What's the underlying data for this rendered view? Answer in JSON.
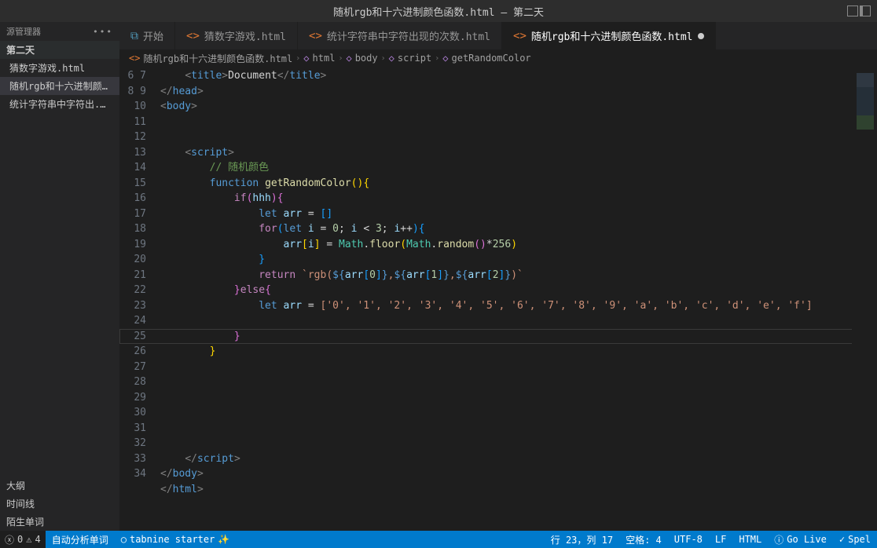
{
  "title": "随机rgb和十六进制颜色函数.html — 第二天",
  "explorer": {
    "label": "源管理器",
    "section": "第二天",
    "files": [
      "猜数字游戏.html",
      "随机rgb和十六进制颜...",
      "统计字符串中字符出..."
    ],
    "activeIndex": 1,
    "bottom": [
      "大纲",
      "时间线",
      "陌生单词"
    ]
  },
  "tabs": [
    {
      "label": "开始",
      "icon": "vscode"
    },
    {
      "label": "猜数字游戏.html",
      "icon": "html"
    },
    {
      "label": "统计字符串中字符出现的次数.html",
      "icon": "html"
    },
    {
      "label": "随机rgb和十六进制颜色函数.html",
      "icon": "html",
      "active": true,
      "dirty": true
    }
  ],
  "breadcrumbs": [
    "随机rgb和十六进制颜色函数.html",
    "html",
    "body",
    "script",
    "getRandomColor"
  ],
  "gutter_start": 6,
  "gutter_end": 34,
  "status": {
    "errors": "0",
    "warnings": "4",
    "autolabel": "自动分析单词",
    "tabnine": "tabnine starter",
    "line": "行 23，列 17",
    "spaces": "空格: 4",
    "encoding": "UTF-8",
    "eol": "LF",
    "lang": "HTML",
    "golive": "Go Live",
    "spell": "Spel"
  },
  "code_strings": {
    "document": "Document",
    "comment": "// 随机颜色",
    "fn": "getRandomColor",
    "rgb_tpl_open": "`rgb(",
    "hex_array": "['0', '1', '2', '3', '4', '5', '6', '7', '8', '9', 'a', 'b', 'c', 'd', 'e', 'f']"
  }
}
